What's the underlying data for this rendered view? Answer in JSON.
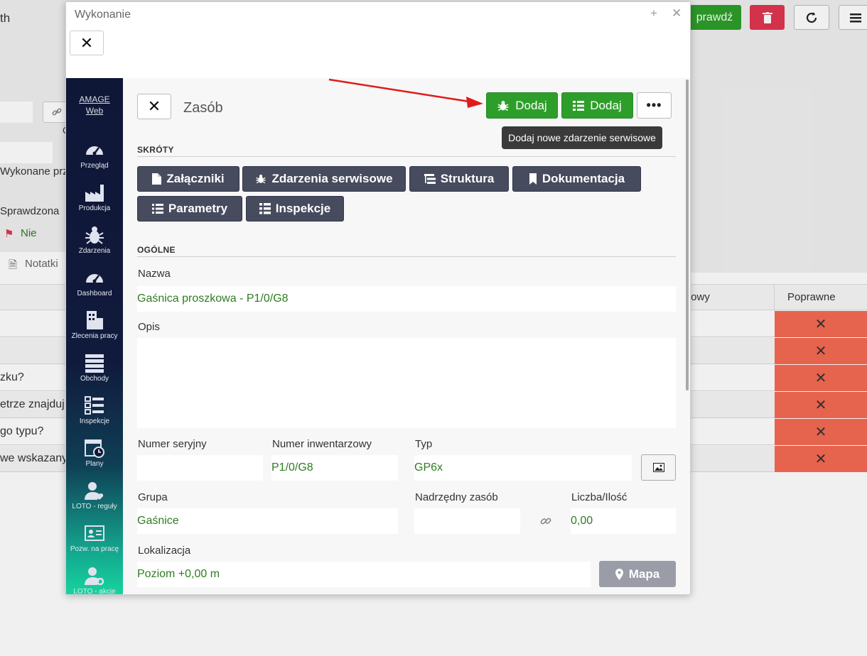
{
  "background": {
    "top_left_text": "th",
    "check_button": "prawdź",
    "fields": {
      "wykonane": "Wykonane prz",
      "sprawdzona_label": "Sprawdzona",
      "sprawdzona_value": "Nie",
      "notatki": "Notatki",
      "c_letter": "C"
    },
    "table": {
      "headers": [
        "towy",
        "Poprawne"
      ],
      "row_texts": [
        "",
        "",
        "zku?",
        "etrze znajduj",
        "go typu?",
        "we wskazany"
      ]
    }
  },
  "dialog": {
    "title": "Wykonanie",
    "sidebar": {
      "logo_line1": "AMAGE",
      "logo_line2": "Web",
      "items": [
        {
          "label": "Przegląd",
          "icon": "gauge-icon"
        },
        {
          "label": "Produkcja",
          "icon": "factory-icon"
        },
        {
          "label": "Zdarzenia",
          "icon": "bug-icon"
        },
        {
          "label": "Dashboard",
          "icon": "gauge-icon"
        },
        {
          "label": "Zlecenia pracy",
          "icon": "building-icon"
        },
        {
          "label": "Obchody",
          "icon": "list-icon"
        },
        {
          "label": "Inspekcje",
          "icon": "checklist-icon"
        },
        {
          "label": "Plany",
          "icon": "calendar-clock-icon"
        },
        {
          "label": "LOTO - reguły",
          "icon": "user-heart-icon"
        },
        {
          "label": "Pozw. na pracę",
          "icon": "id-card-icon"
        },
        {
          "label": "LOTO - akcje",
          "icon": "user-cog-icon"
        }
      ]
    },
    "content": {
      "title": "Zasób",
      "add_event_label": "Dodaj",
      "add_list_label": "Dodaj",
      "more_label": "•••",
      "tooltip": "Dodaj nowe zdarzenie serwisowe",
      "shortcuts_title": "SKRÓTY",
      "shortcuts": [
        {
          "label": "Załączniki",
          "icon": "file-icon"
        },
        {
          "label": "Zdarzenia serwisowe",
          "icon": "bug-icon"
        },
        {
          "label": "Struktura",
          "icon": "tree-icon"
        },
        {
          "label": "Dokumentacja",
          "icon": "bookmark-icon"
        },
        {
          "label": "Parametry",
          "icon": "list-icon"
        },
        {
          "label": "Inspekcje",
          "icon": "checklist-icon"
        }
      ],
      "general_title": "OGÓLNE",
      "nazwa_label": "Nazwa",
      "nazwa_value": "Gaśnica proszkowa - P1/0/G8",
      "opis_label": "Opis",
      "opis_value": "",
      "serial_label": "Numer seryjny",
      "serial_value": "",
      "inventory_label": "Numer inwentarzowy",
      "inventory_value": "P1/0/G8",
      "type_label": "Typ",
      "type_value": "GP6x",
      "group_label": "Grupa",
      "group_value": "Gaśnice",
      "parent_label": "Nadrzędny zasób",
      "parent_value": "",
      "qty_label": "Liczba/Ilość",
      "qty_value": "0,00",
      "location_label": "Lokalizacja",
      "location_value": "Poziom +0,00 m",
      "map_label": "Mapa"
    }
  },
  "colors": {
    "green_button": "#2e9e2a",
    "dark_button": "#474b5e",
    "field_text": "#2e7d20",
    "incorrect_cell": "#f56b52",
    "sidebar_top": "#0f1737",
    "sidebar_bottom": "#17d39e",
    "annotation_arrow": "#e11b1b"
  }
}
